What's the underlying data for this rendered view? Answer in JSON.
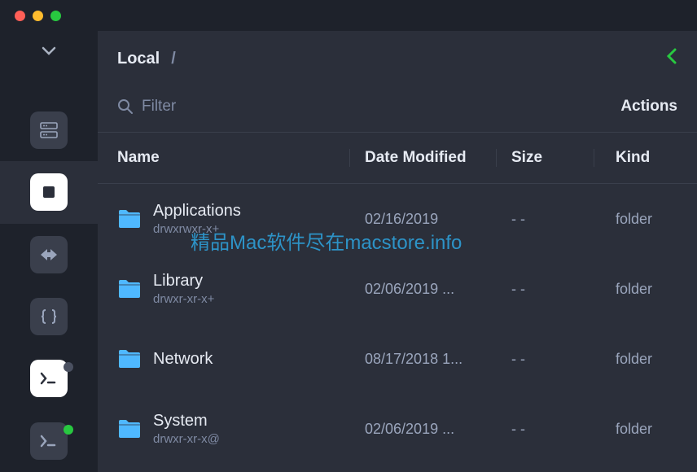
{
  "breadcrumb": {
    "root": "Local",
    "sep": "/"
  },
  "filter": {
    "placeholder": "Filter"
  },
  "actions_label": "Actions",
  "columns": {
    "name": "Name",
    "date": "Date Modified",
    "size": "Size",
    "kind": "Kind"
  },
  "rows": [
    {
      "name": "Applications",
      "perms": "drwxrwxr-x+",
      "date": "02/16/2019",
      "size": "- -",
      "kind": "folder"
    },
    {
      "name": "Library",
      "perms": "drwxr-xr-x+",
      "date": "02/06/2019 ...",
      "size": "- -",
      "kind": "folder"
    },
    {
      "name": "Network",
      "perms": "",
      "date": "08/17/2018 1...",
      "size": "- -",
      "kind": "folder"
    },
    {
      "name": "System",
      "perms": "drwxr-xr-x@",
      "date": "02/06/2019 ...",
      "size": "- -",
      "kind": "folder"
    }
  ],
  "watermark": "精品Mac软件尽在macstore.info"
}
